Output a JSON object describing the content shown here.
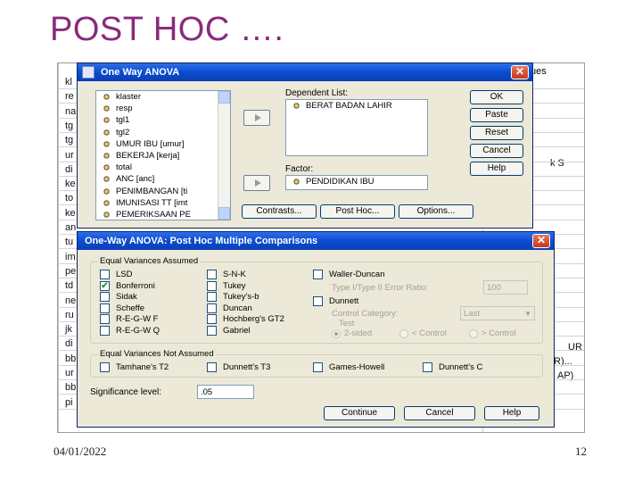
{
  "slide": {
    "title": "POST HOC ….",
    "footer_date": "04/01/2022",
    "page_number": "12"
  },
  "sheet": {
    "row_fragments": [
      "kl",
      "re",
      "na",
      "tg",
      "tg",
      "ur",
      "di",
      "ke",
      "to",
      "ke",
      "an",
      "tu",
      "im",
      "pe",
      "td",
      "ne",
      "ru",
      "jk",
      "di",
      "bb",
      "ur",
      "bb",
      "pi"
    ],
    "header_fragment": "ues",
    "right_fragments": {
      "row7": "k  S",
      "row20": "UR",
      "row21": "R)...",
      "row22": "AP)"
    }
  },
  "anova_dialog": {
    "title": "One Way ANOVA",
    "variables": [
      "klaster",
      "resp",
      "tgl1",
      "tgl2",
      "UMUR IBU [umur]",
      "BEKERJA [kerja]",
      "total",
      "ANC [anc]",
      "PENIMBANGAN [ti",
      "IMUNISASI TT [imt",
      "PEMERIKSAAN PE"
    ],
    "dependent_label": "Dependent List:",
    "dependent_items": [
      "BERAT BADAN LAHIR"
    ],
    "factor_label": "Factor:",
    "factor_value": "PENDIDIKAN IBU",
    "buttons": {
      "ok": "OK",
      "paste": "Paste",
      "reset": "Reset",
      "cancel": "Cancel",
      "help": "Help"
    },
    "bottom_buttons": {
      "contrasts": "Contrasts...",
      "post_hoc": "Post Hoc...",
      "options": "Options..."
    }
  },
  "posthoc_dialog": {
    "title": "One-Way ANOVA: Post Hoc Multiple Comparisons",
    "equal_title": "Equal Variances Assumed",
    "col1": [
      {
        "label": "LSD",
        "checked": false
      },
      {
        "label": "Bonferroni",
        "checked": true
      },
      {
        "label": "Sidak",
        "checked": false
      },
      {
        "label": "Scheffe",
        "checked": false
      },
      {
        "label": "R-E-G-W F",
        "checked": false
      },
      {
        "label": "R-E-G-W Q",
        "checked": false
      }
    ],
    "col2": [
      {
        "label": "S-N-K",
        "checked": false
      },
      {
        "label": "Tukey",
        "checked": false
      },
      {
        "label": "Tukey's-b",
        "checked": false
      },
      {
        "label": "Duncan",
        "checked": false
      },
      {
        "label": "Hochberg's GT2",
        "checked": false
      },
      {
        "label": "Gabriel",
        "checked": false
      }
    ],
    "waller": {
      "label": "Waller-Duncan",
      "ratio_label": "Type I/Type II Error Ratio:",
      "ratio_value": "100"
    },
    "dunnett": {
      "label": "Dunnett",
      "control_label": "Control Category:",
      "control_value": "Last",
      "test_label": "Test",
      "sided_2": "2-sided",
      "less": "< Control",
      "greater": "> Control"
    },
    "not_assumed_title": "Equal Variances Not Assumed",
    "not_assumed": [
      {
        "label": "Tamhane's T2",
        "checked": false
      },
      {
        "label": "Dunnett's T3",
        "checked": false
      },
      {
        "label": "Games-Howell",
        "checked": false
      },
      {
        "label": "Dunnett's C",
        "checked": false
      }
    ],
    "sig_label": "Significance level:",
    "sig_value": ".05",
    "buttons": {
      "continue": "Continue",
      "cancel": "Cancel",
      "help": "Help"
    }
  }
}
